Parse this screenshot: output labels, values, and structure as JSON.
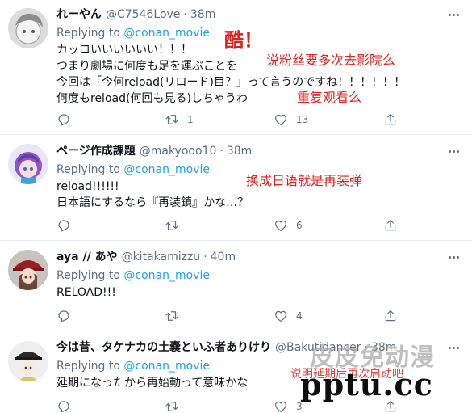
{
  "tweets": [
    {
      "name": "れーやん",
      "handle": "@C7546Love",
      "dot": "·",
      "time": "38m",
      "replying_prefix": "Replying to ",
      "replying_to": "@conan_movie",
      "lines": [
        "カッコいいいいいい！！！",
        "つまり劇場に何度も足を運ぶことを",
        "今回は「今何reload(リロード)目？」って言うのですね！！！！！！",
        "何度もreload(何回も見る)しちゃうわ"
      ],
      "reply_count": "",
      "retweet_count": "1",
      "like_count": "13"
    },
    {
      "name": "ページ作成課題",
      "handle": "@makyooo10",
      "dot": "·",
      "time": "38m",
      "replying_prefix": "Replying to ",
      "replying_to": "@conan_movie",
      "lines": [
        "reload!!!!!!",
        "日本語にするなら『再装鎮』かな…？"
      ],
      "reply_count": "",
      "retweet_count": "",
      "like_count": "6"
    },
    {
      "name": "aya // あや",
      "handle": "@kitakamizzu",
      "dot": "·",
      "time": "40m",
      "replying_prefix": "Replying to ",
      "replying_to": "@conan_movie",
      "lines": [
        "RELOAD!!!"
      ],
      "reply_count": "",
      "retweet_count": "",
      "like_count": "4"
    },
    {
      "name": "今は昔、タケナカの土嚢といふ者ありけり",
      "handle": "@Bakutidancer",
      "dot": "·",
      "time": "38m",
      "replying_prefix": "Replying to ",
      "replying_to": "@conan_movie",
      "lines": [
        "延期になったから再始動って意味かな"
      ],
      "reply_count": "",
      "retweet_count": "",
      "like_count": "3"
    }
  ],
  "annotations": {
    "cool": "酷！",
    "fans_note": "说粉丝要多次去影院么",
    "rewatch": "重复观看么",
    "japanese_note": "换成日语就是再装弹",
    "last_note": "说明延期后再次启动吧"
  },
  "watermark": {
    "site_cn": "皮皮免动漫",
    "site_url": "pptu.cc"
  },
  "colors": {
    "accent": "#1da1f2",
    "secondary_text": "#5b7083",
    "annotation": "#e0201c",
    "divider": "#e6ecf0"
  },
  "icons": [
    "reply-icon",
    "retweet-icon",
    "like-icon",
    "share-icon",
    "more-icon"
  ]
}
